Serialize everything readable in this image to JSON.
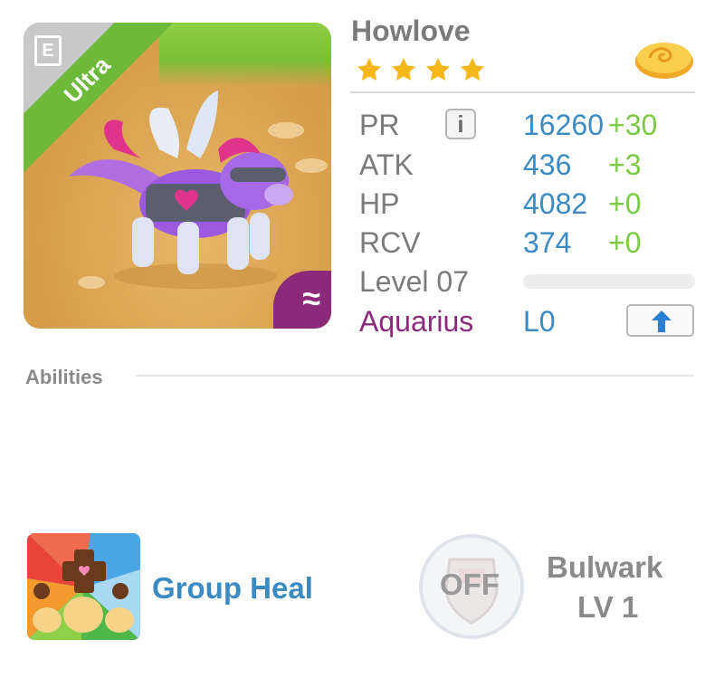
{
  "monster": {
    "name": "Howlove",
    "rarity": "Ultra",
    "evolution_icon_letter": "E",
    "element_symbol": "≈",
    "star_count": 4,
    "image_description_icon": "winged-purple-wolf-image"
  },
  "stats": [
    {
      "label": "PR",
      "value": "16260",
      "bonus": "+30"
    },
    {
      "label": "ATK",
      "value": "436",
      "bonus": "+3"
    },
    {
      "label": "HP",
      "value": "4082",
      "bonus": "+0"
    },
    {
      "label": "RCV",
      "value": "374",
      "bonus": "+0"
    }
  ],
  "info_button_label": "i",
  "level": {
    "label": "Level 07",
    "progress": 0.0
  },
  "zodiac": {
    "label": "Aquarius",
    "level": "L0"
  },
  "abilities": {
    "section_label": "Abilities",
    "ability_1": {
      "name": "Group Heal",
      "icon": "group-heal-icon"
    },
    "ability_2": {
      "name": "Bulwark",
      "level": "LV 1",
      "state": "OFF",
      "icon": "shield-icon"
    }
  },
  "colors": {
    "accent_blue": "#3b8ac2",
    "bonus_green": "#7ccb46",
    "zodiac_purple": "#8b2a7a",
    "rarity_green": "#6dba3a",
    "star_gold": "#f6b71a"
  }
}
